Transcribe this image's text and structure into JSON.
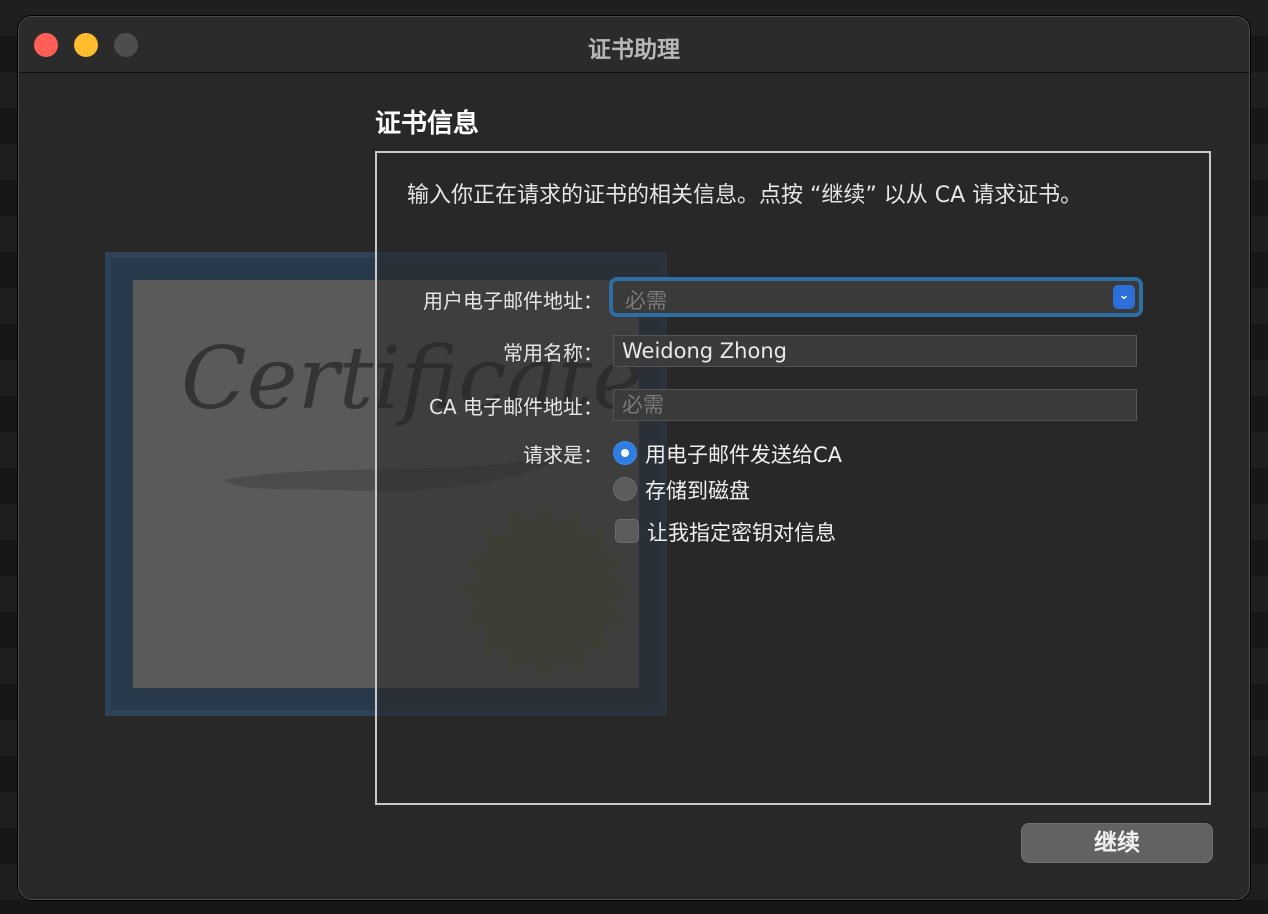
{
  "window": {
    "title": "证书助理"
  },
  "section": {
    "title": "证书信息",
    "intro": "输入你正在请求的证书的相关信息。点按 “继续” 以从 CA 请求证书。"
  },
  "form": {
    "user_email": {
      "label": "用户电子邮件地址：",
      "value": "",
      "placeholder": "必需"
    },
    "common_name": {
      "label": "常用名称：",
      "value": "Weidong Zhong"
    },
    "ca_email": {
      "label": "CA 电子邮件地址：",
      "value": "",
      "placeholder": "必需"
    },
    "request": {
      "label": "请求是：",
      "options": [
        {
          "label": "用电子邮件发送给CA",
          "selected": true
        },
        {
          "label": "存储到磁盘",
          "selected": false
        }
      ]
    },
    "key_pair": {
      "label": "让我指定密钥对信息",
      "checked": false
    }
  },
  "illustration": {
    "script_text": "Certificate"
  },
  "buttons": {
    "continue": "继续"
  },
  "colors": {
    "accent": "#2f7de1",
    "focus_ring": "#2d6ea3"
  }
}
